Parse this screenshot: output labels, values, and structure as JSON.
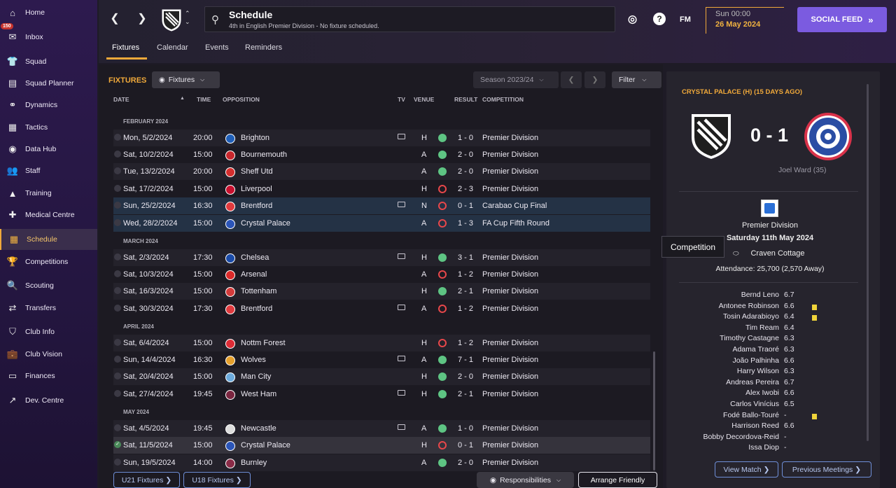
{
  "sidebar": {
    "items": [
      {
        "label": "Home",
        "icon": "home-icon",
        "glyph": "⌂"
      },
      {
        "label": "Inbox",
        "icon": "inbox-icon",
        "glyph": "✉",
        "badge": "150"
      },
      {
        "label": "Squad",
        "icon": "squad-icon",
        "glyph": "👕"
      },
      {
        "label": "Squad Planner",
        "icon": "clipboard-icon",
        "glyph": "▤"
      },
      {
        "label": "Dynamics",
        "icon": "dynamics-icon",
        "glyph": "⚭"
      },
      {
        "label": "Tactics",
        "icon": "tactics-icon",
        "glyph": "▦"
      },
      {
        "label": "Data Hub",
        "icon": "data-hub-icon",
        "glyph": "◉"
      },
      {
        "label": "Staff",
        "icon": "staff-icon",
        "glyph": "👥"
      },
      {
        "label": "Training",
        "icon": "training-icon",
        "glyph": "▲"
      },
      {
        "label": "Medical Centre",
        "icon": "medical-icon",
        "glyph": "✚"
      },
      {
        "label": "Schedule",
        "icon": "calendar-icon",
        "glyph": "▦",
        "active": true
      },
      {
        "label": "Competitions",
        "icon": "trophy-icon",
        "glyph": "🏆"
      },
      {
        "label": "Scouting",
        "icon": "scouting-icon",
        "glyph": "🔍"
      },
      {
        "label": "Transfers",
        "icon": "transfers-icon",
        "glyph": "⇄"
      },
      {
        "label": "Club Info",
        "icon": "shield-icon",
        "glyph": "⛉"
      },
      {
        "label": "Club Vision",
        "icon": "briefcase-icon",
        "glyph": "💼"
      },
      {
        "label": "Finances",
        "icon": "finances-icon",
        "glyph": "▭"
      },
      {
        "label": "Dev. Centre",
        "icon": "dev-centre-icon",
        "glyph": "↗"
      }
    ]
  },
  "topbar": {
    "title": "Schedule",
    "subtitle": "4th in English Premier Division - No fixture scheduled.",
    "fm_label": "FM",
    "time": "Sun 00:00",
    "date": "26 May 2024",
    "social_feed": "SOCIAL FEED",
    "tabs": [
      "Fixtures",
      "Calendar",
      "Events",
      "Reminders"
    ]
  },
  "fixtures": {
    "title": "FIXTURES",
    "dropdown": "Fixtures",
    "season": "Season 2023/24",
    "filter": "Filter",
    "headers": {
      "date": "DATE",
      "time": "TIME",
      "opposition": "OPPOSITION",
      "tv": "TV",
      "venue": "VENUE",
      "result": "RESULT",
      "competition": "COMPETITION"
    },
    "months": [
      "FEBRUARY 2024",
      "MARCH 2024",
      "APRIL 2024",
      "MAY 2024"
    ],
    "rows": [
      {
        "date": "Mon, 5/2/2024",
        "time": "20:00",
        "opp": "Brighton",
        "crest": "#1f5fb8",
        "tv": true,
        "venue": "H",
        "outcome": "win",
        "score": "1 - 0",
        "comp": "Premier Division"
      },
      {
        "date": "Sat, 10/2/2024",
        "time": "15:00",
        "opp": "Bournemouth",
        "crest": "#c8272d",
        "tv": false,
        "venue": "A",
        "outcome": "win",
        "score": "2 - 0",
        "comp": "Premier Division"
      },
      {
        "date": "Tue, 13/2/2024",
        "time": "20:00",
        "opp": "Sheff Utd",
        "crest": "#d42e2e",
        "tv": false,
        "venue": "A",
        "outcome": "win",
        "score": "2 - 0",
        "comp": "Premier Division"
      },
      {
        "date": "Sat, 17/2/2024",
        "time": "15:00",
        "opp": "Liverpool",
        "crest": "#c8102e",
        "tv": false,
        "venue": "H",
        "outcome": "loss",
        "score": "2 - 3",
        "comp": "Premier Division"
      },
      {
        "date": "Sun, 25/2/2024",
        "time": "16:30",
        "opp": "Brentford",
        "crest": "#e03a3e",
        "tv": true,
        "venue": "N",
        "outcome": "loss",
        "score": "0 - 1",
        "comp": "Carabao Cup Final"
      },
      {
        "date": "Wed, 28/2/2024",
        "time": "15:00",
        "opp": "Crystal Palace",
        "crest": "#2b55b8",
        "tv": false,
        "venue": "A",
        "outcome": "loss",
        "score": "1 - 3",
        "comp": "FA Cup Fifth Round"
      },
      {
        "date": "Sat, 2/3/2024",
        "time": "17:30",
        "opp": "Chelsea",
        "crest": "#1a4ba8",
        "tv": true,
        "venue": "H",
        "outcome": "win",
        "score": "3 - 1",
        "comp": "Premier Division"
      },
      {
        "date": "Sat, 10/3/2024",
        "time": "15:00",
        "opp": "Arsenal",
        "crest": "#db2a2a",
        "tv": false,
        "venue": "A",
        "outcome": "loss",
        "score": "1 - 2",
        "comp": "Premier Division"
      },
      {
        "date": "Sat, 16/3/2024",
        "time": "15:00",
        "opp": "Tottenham",
        "crest": "#d33b3b",
        "tv": false,
        "venue": "H",
        "outcome": "win",
        "score": "2 - 1",
        "comp": "Premier Division"
      },
      {
        "date": "Sat, 30/3/2024",
        "time": "17:30",
        "opp": "Brentford",
        "crest": "#e03a3e",
        "tv": true,
        "venue": "A",
        "outcome": "loss",
        "score": "1 - 2",
        "comp": "Premier Division"
      },
      {
        "date": "Sat, 6/4/2024",
        "time": "15:00",
        "opp": "Nottm Forest",
        "crest": "#dd2c36",
        "tv": false,
        "venue": "H",
        "outcome": "loss",
        "score": "1 - 2",
        "comp": "Premier Division"
      },
      {
        "date": "Sun, 14/4/2024",
        "time": "16:30",
        "opp": "Wolves",
        "crest": "#e5a02c",
        "tv": true,
        "venue": "A",
        "outcome": "win",
        "score": "7 - 1",
        "comp": "Premier Division"
      },
      {
        "date": "Sat, 20/4/2024",
        "time": "15:00",
        "opp": "Man City",
        "crest": "#6cabdd",
        "tv": false,
        "venue": "H",
        "outcome": "win",
        "score": "2 - 0",
        "comp": "Premier Division"
      },
      {
        "date": "Sat, 27/4/2024",
        "time": "19:45",
        "opp": "West Ham",
        "crest": "#7a2640",
        "tv": true,
        "venue": "H",
        "outcome": "win",
        "score": "2 - 1",
        "comp": "Premier Division"
      },
      {
        "date": "Sat, 4/5/2024",
        "time": "19:45",
        "opp": "Newcastle",
        "crest": "#dddddd",
        "tv": true,
        "venue": "A",
        "outcome": "win",
        "score": "1 - 0",
        "comp": "Premier Division"
      },
      {
        "date": "Sat, 11/5/2024",
        "time": "15:00",
        "opp": "Crystal Palace",
        "crest": "#2b55b8",
        "tv": false,
        "venue": "H",
        "outcome": "loss",
        "score": "0 - 1",
        "comp": "Premier Division"
      },
      {
        "date": "Sun, 19/5/2024",
        "time": "14:00",
        "opp": "Burnley",
        "crest": "#8a2b47",
        "tv": false,
        "venue": "A",
        "outcome": "win",
        "score": "2 - 0",
        "comp": "Premier Division"
      }
    ],
    "buttons": {
      "u21": "U21 Fixtures",
      "u18": "U18 Fixtures",
      "responsibilities": "Responsibilities",
      "arrange": "Arrange Friendly"
    }
  },
  "match": {
    "title": "CRYSTAL PALACE (H) (15 DAYS AGO)",
    "score": "0 - 1",
    "scorer": "Joel Ward (35)",
    "competition": "Premier Division",
    "date": "Saturday 11th May 2024",
    "stadium": "Craven Cottage",
    "attendance": "Attendance: 25,700 (2,570 Away)",
    "players": [
      {
        "name": "Bernd Leno",
        "rating": "6.7",
        "yellow": false
      },
      {
        "name": "Antonee Robinson",
        "rating": "6.6",
        "yellow": true
      },
      {
        "name": "Tosin Adarabioyo",
        "rating": "6.4",
        "yellow": true
      },
      {
        "name": "Tim Ream",
        "rating": "6.4",
        "yellow": false
      },
      {
        "name": "Timothy Castagne",
        "rating": "6.3",
        "yellow": false
      },
      {
        "name": "Adama Traoré",
        "rating": "6.3",
        "yellow": false
      },
      {
        "name": "João Palhinha",
        "rating": "6.6",
        "yellow": false
      },
      {
        "name": "Harry Wilson",
        "rating": "6.3",
        "yellow": false
      },
      {
        "name": "Andreas Pereira",
        "rating": "6.7",
        "yellow": false
      },
      {
        "name": "Alex Iwobi",
        "rating": "6.6",
        "yellow": false
      },
      {
        "name": "Carlos Vinícius",
        "rating": "6.5",
        "yellow": false
      },
      {
        "name": "Fodé Ballo-Touré",
        "rating": "-",
        "yellow": true
      },
      {
        "name": "Harrison Reed",
        "rating": "6.6",
        "yellow": false
      },
      {
        "name": "Bobby Decordova-Reid",
        "rating": "-",
        "yellow": false
      },
      {
        "name": "Issa Diop",
        "rating": "-",
        "yellow": false
      }
    ],
    "view_match": "View Match",
    "previous_meetings": "Previous Meetings"
  },
  "tooltip": "Competition"
}
